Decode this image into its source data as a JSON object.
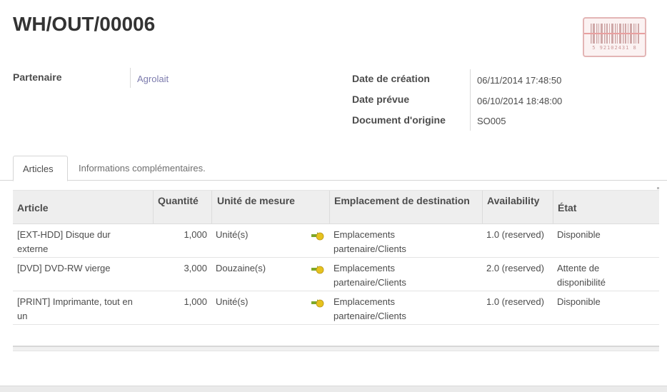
{
  "header": {
    "title": "WH/OUT/00006",
    "barcode_number": "5 92102431 8"
  },
  "fields": {
    "partner_label": "Partenaire",
    "partner_value": "Agrolait",
    "creation_date_label": "Date de création",
    "creation_date_value": "06/11/2014 17:48:50",
    "scheduled_date_label": "Date prévue",
    "scheduled_date_value": "06/10/2014 18:48:00",
    "source_doc_label": "Document d'origine",
    "source_doc_value": "SO005"
  },
  "tabs": [
    {
      "label": "Articles",
      "active": true
    },
    {
      "label": "Informations complémentaires.",
      "active": false
    }
  ],
  "table": {
    "columns": [
      "Article",
      "Quantité",
      "Unité de mesure",
      "Emplacement de destination",
      "Availability",
      "État"
    ],
    "rows": [
      {
        "article": [
          "[EXT-HDD] Disque dur",
          "externe"
        ],
        "quantity": "1,000",
        "uom": "Unité(s)",
        "destination": [
          "Emplacements",
          "partenaire/Clients"
        ],
        "availability": "1.0 (reserved)",
        "state": [
          "Disponible"
        ]
      },
      {
        "article": [
          "[DVD] DVD-RW vierge"
        ],
        "quantity": "3,000",
        "uom": "Douzaine(s)",
        "destination": [
          "Emplacements",
          "partenaire/Clients"
        ],
        "availability": "2.0 (reserved)",
        "state": [
          "Attente de",
          "disponibilité"
        ]
      },
      {
        "article": [
          "[PRINT] Imprimante, tout en",
          "un"
        ],
        "quantity": "1,000",
        "uom": "Unité(s)",
        "destination": [
          "Emplacements",
          "partenaire/Clients"
        ],
        "availability": "1.0 (reserved)",
        "state": [
          "Disponible"
        ]
      }
    ]
  },
  "colors": {
    "link": "#7c7bad",
    "header_bg": "#eeeeee",
    "text": "#4c4c4c"
  },
  "icons": {
    "barcode": "barcode-icon",
    "route": "route-arrow-icon"
  }
}
